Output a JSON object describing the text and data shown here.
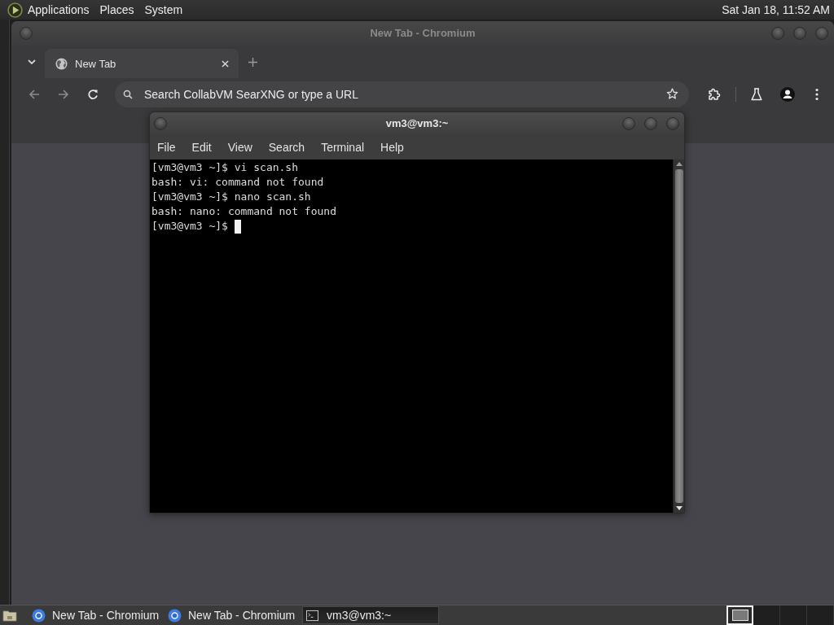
{
  "top_panel": {
    "menus": [
      {
        "label": "Applications"
      },
      {
        "label": "Places"
      },
      {
        "label": "System"
      }
    ],
    "clock": "Sat Jan 18, 11:52 AM"
  },
  "browser_window": {
    "title": "New Tab - Chromium",
    "tabs": [
      {
        "label": "New Tab",
        "selected": true
      }
    ],
    "address_bar": {
      "placeholder": "Search CollabVM SearXNG or type a URL"
    }
  },
  "terminal_window": {
    "title": "vm3@vm3:~",
    "menu": [
      "File",
      "Edit",
      "View",
      "Search",
      "Terminal",
      "Help"
    ],
    "lines": [
      "[vm3@vm3 ~]$ vi scan.sh",
      "bash: vi: command not found",
      "[vm3@vm3 ~]$ nano scan.sh",
      "bash: nano: command not found",
      "[vm3@vm3 ~]$"
    ]
  },
  "taskbar": {
    "tasks": [
      {
        "label": "New Tab - Chromium",
        "kind": "browser",
        "selected": false
      },
      {
        "label": "New Tab - Chromium",
        "kind": "browser",
        "selected": false
      },
      {
        "label": "vm3@vm3:~",
        "kind": "terminal",
        "selected": true
      }
    ],
    "workspaces": [
      {
        "selected": true
      },
      {
        "selected": false
      },
      {
        "selected": false
      },
      {
        "selected": false
      }
    ]
  }
}
